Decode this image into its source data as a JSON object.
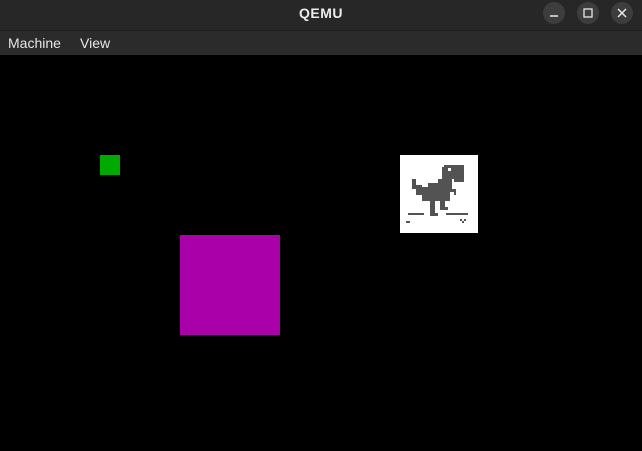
{
  "window": {
    "title": "QEMU",
    "buttons": {
      "minimize_icon": "minimize-icon",
      "maximize_icon": "maximize-icon",
      "close_icon": "close-icon"
    }
  },
  "menubar": {
    "items": [
      {
        "label": "Machine"
      },
      {
        "label": "View"
      }
    ]
  },
  "display": {
    "background": "#000000",
    "objects": [
      {
        "kind": "square",
        "color": "#00aa00"
      },
      {
        "kind": "square",
        "color": "#aa00aa"
      },
      {
        "kind": "sprite",
        "icon": "dinosaur-icon",
        "background": "#ffffff",
        "sprite_color": "#535353"
      }
    ]
  }
}
